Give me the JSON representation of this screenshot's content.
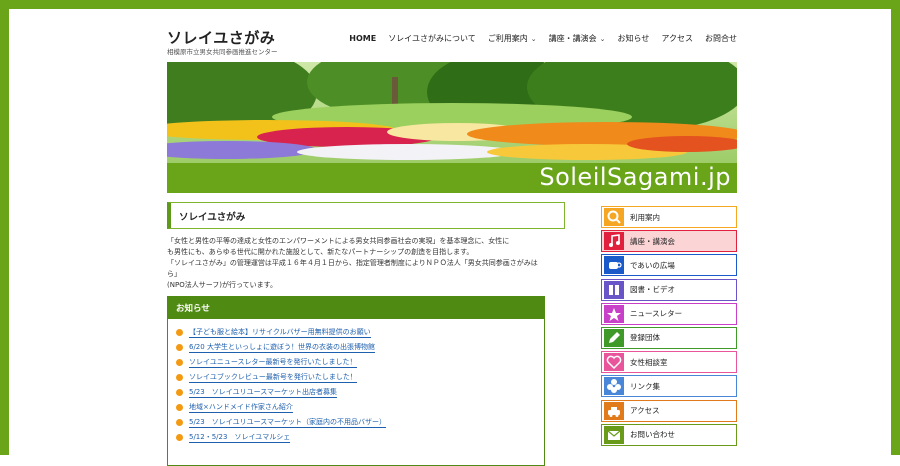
{
  "header": {
    "title": "ソレイユさがみ",
    "subtitle": "相模原市立男女共同参画推進センター"
  },
  "nav": [
    {
      "label": "HOME",
      "dropdown": false,
      "active": true
    },
    {
      "label": "ソレイユさがみについて",
      "dropdown": false
    },
    {
      "label": "ご利用案内",
      "dropdown": true
    },
    {
      "label": "講座・講演会",
      "dropdown": true
    },
    {
      "label": "お知らせ",
      "dropdown": false
    },
    {
      "label": "アクセス",
      "dropdown": false
    },
    {
      "label": "お問合せ",
      "dropdown": false
    }
  ],
  "hero": {
    "brand_text": "SoleilSagami.jp"
  },
  "main": {
    "heading": "ソレイユさがみ",
    "intro": [
      "「女性と男性の平等の達成と女性のエンパワーメントによる男女共同参画社会の実現」を基本理念に、女性に",
      "も男性にも、あらゆる世代に開かれた施設として、新たなパートナーシップの創造を目指します。",
      "「ソレイユさがみ」の管理運営は平成１６年４月１日から、指定管理者制度によりＮＰＯ法人「男女共同参画さがみはら」",
      "(NPO法人サーフ)が行っています。"
    ]
  },
  "news": {
    "title": "お知らせ",
    "items": [
      "【子ども服と絵本】リサイクルバザー用無料提供のお願い",
      "6/20 大学生といっしょに遊ぼう！世界の衣装の出張博物館",
      "ソレイユニュースレター最新号を発行いたしました！",
      "ソレイユブックレビュー最新号を発行いたしました！",
      "5/23　ソレイユリユースマーケット出店者募集",
      "地域×ハンドメイド作家さん紹介",
      "5/23　ソレイユリユースマーケット（家庭内の不用品バザー）",
      "5/12・5/23　ソレイユマルシェ"
    ]
  },
  "side_menu": [
    {
      "label": "利用案内",
      "icon": "search-icon",
      "color": "#f5a623",
      "border": "#f5a623",
      "bg": "#ffffff"
    },
    {
      "label": "講座・講演会",
      "icon": "music-note-icon",
      "color": "#e0203c",
      "border": "#e0203c",
      "bg": "#fbd4d6"
    },
    {
      "label": "であいの広場",
      "icon": "coffee-cup-icon",
      "color": "#1a5bc9",
      "border": "#1a5bc9",
      "bg": "#ffffff"
    },
    {
      "label": "図書・ビデオ",
      "icon": "library-icon",
      "color": "#6a55c8",
      "border": "#6a55c8",
      "bg": "#ffffff"
    },
    {
      "label": "ニュースレター",
      "icon": "star-icon",
      "color": "#c740c7",
      "border": "#c740c7",
      "bg": "#ffffff"
    },
    {
      "label": "登録団体",
      "icon": "pencil-icon",
      "color": "#3f9a2a",
      "border": "#3f9a2a",
      "bg": "#ffffff"
    },
    {
      "label": "女性相談室",
      "icon": "heart-icon",
      "color": "#e8559b",
      "border": "#e8559b",
      "bg": "#ffffff"
    },
    {
      "label": "リンク集",
      "icon": "flower-icon",
      "color": "#4a86d8",
      "border": "#4a86d8",
      "bg": "#ffffff"
    },
    {
      "label": "アクセス",
      "icon": "car-icon",
      "color": "#e07a1a",
      "border": "#e07a1a",
      "bg": "#ffffff"
    },
    {
      "label": "お問い合わせ",
      "icon": "mail-icon",
      "color": "#6a9a1a",
      "border": "#6a9a1a",
      "bg": "#ffffff"
    }
  ],
  "colors": {
    "frame": "#6aa519",
    "news_header": "#4f8a12",
    "link": "#1e5fae",
    "bullet": "#f39a12"
  }
}
